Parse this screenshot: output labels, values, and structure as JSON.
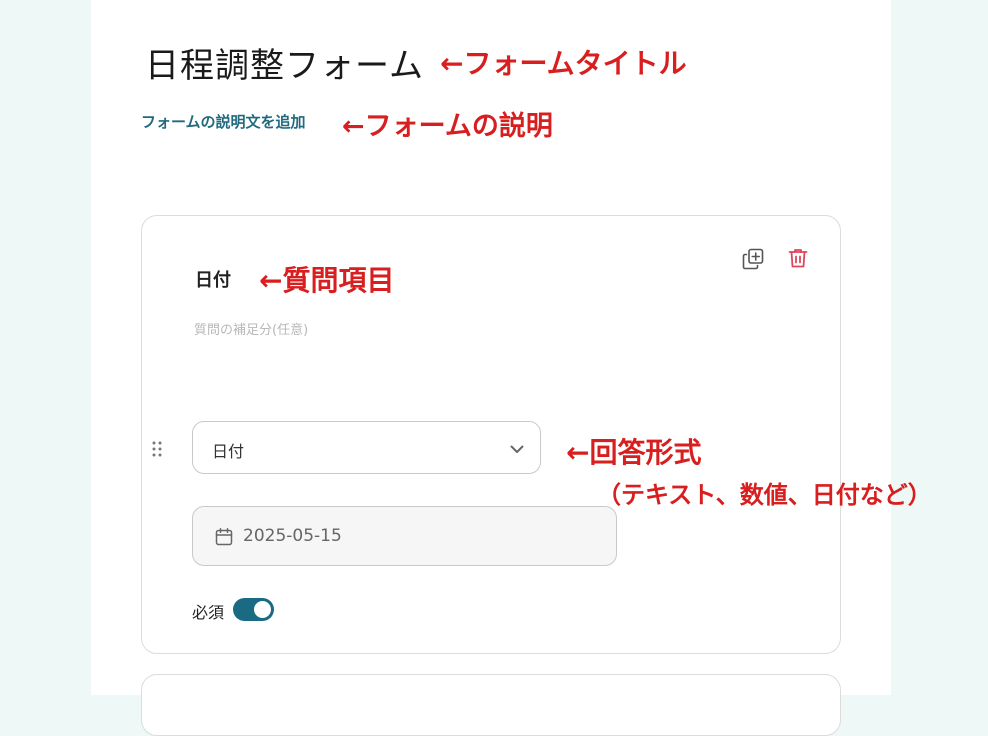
{
  "form": {
    "title": "日程調整フォーム",
    "description_placeholder": "フォームの説明文を追加"
  },
  "question": {
    "title": "日付",
    "subtitle_placeholder": "質問の補足分(任意)",
    "answer_type": "日付",
    "date_value": "2025-05-15",
    "required_label": "必須",
    "required": true
  },
  "annotations": {
    "form_title": "←フォームタイトル",
    "form_description": "←フォームの説明",
    "question_item": "←質問項目",
    "answer_format": "←回答形式",
    "answer_format_examples": "（テキスト、数値、日付など）"
  },
  "colors": {
    "accent": "#1a6a83",
    "annotation": "#d81e1e",
    "delete": "#e0455a",
    "background": "#eef8f6"
  },
  "icons": [
    "duplicate-icon",
    "trash-icon",
    "drag-handle-icon",
    "chevron-down-icon",
    "calendar-icon"
  ]
}
